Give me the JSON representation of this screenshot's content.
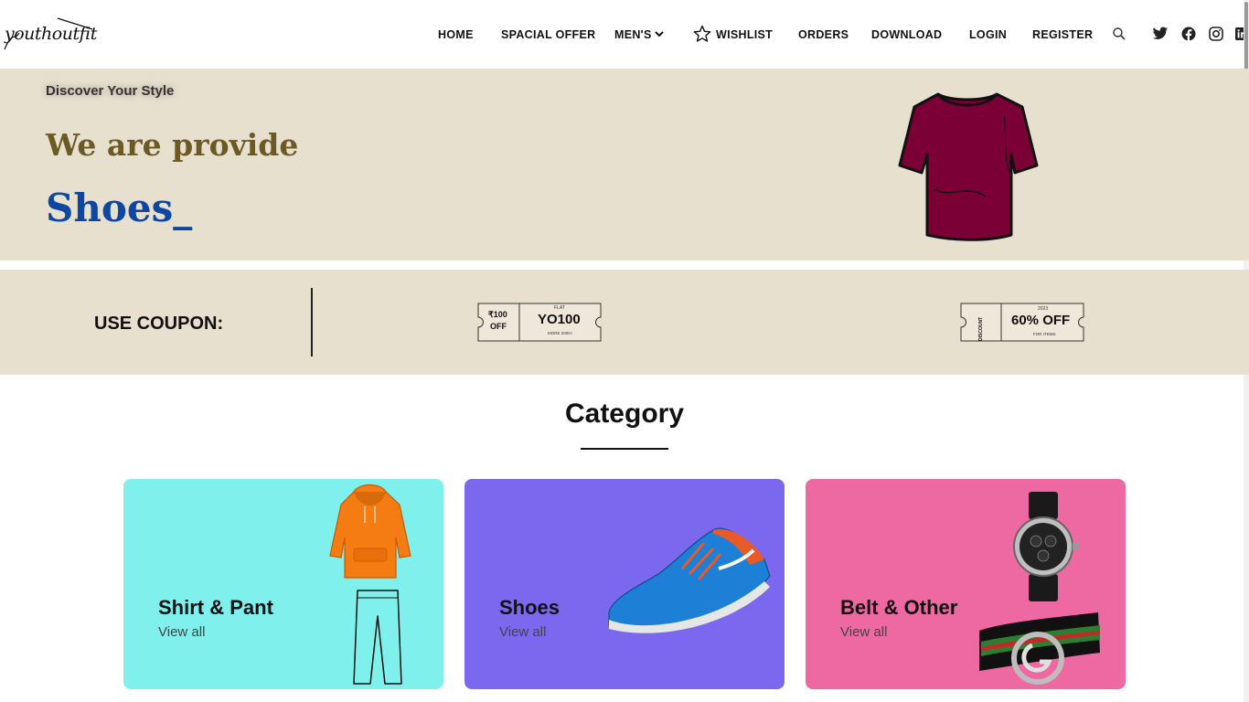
{
  "header": {
    "logo_text": "youthoutfit",
    "nav": [
      "HOME",
      "SPACIAL OFFER",
      "MEN'S",
      "WISHLIST",
      "ORDERS",
      "DOWNLOAD",
      "LOGIN",
      "REGISTER"
    ]
  },
  "hero": {
    "kicker": "Discover Your Style",
    "title": "We are provide",
    "typed": "Shoes_"
  },
  "coupon": {
    "label": "USE COUPON:",
    "ticket1": {
      "stub_amount": "₹100",
      "stub_off": "OFF",
      "flat": "FLAT",
      "code": "YO100",
      "note": "MORE 2000+"
    },
    "ticket2": {
      "stub": "DISCOUNT",
      "year": "2023",
      "offer": "60% OFF",
      "note": "FOR ITEMS"
    }
  },
  "category": {
    "title": "Category",
    "cards": [
      {
        "name": "Shirt & Pant",
        "link": "View all",
        "bg": "#7ff0ec"
      },
      {
        "name": "Shoes",
        "link": "View all",
        "bg": "#7b68ee"
      },
      {
        "name": "Belt & Other",
        "link": "View all",
        "bg": "#ee68a2"
      }
    ]
  },
  "colors": {
    "hero_bg": "#e8e0cf",
    "hero_title": "#6b5a24",
    "hero_typed": "#0d47a1",
    "tshirt": "#7b0035"
  }
}
